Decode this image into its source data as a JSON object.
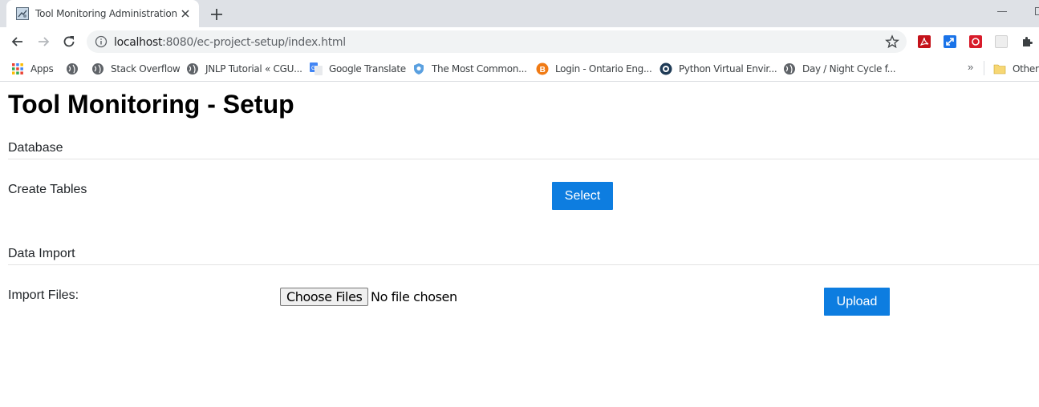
{
  "browser": {
    "tab": {
      "title": "Tool Monitoring Administration",
      "favicon": "tool-page-icon",
      "close_icon": "close-icon"
    },
    "new_tab_icon": "plus-icon",
    "address": {
      "host": "localhost",
      "rest": ":8080/ec-project-setup/index.html"
    },
    "bookmarks": [
      {
        "label": "Apps",
        "icon": "apps-grid-icon"
      },
      {
        "label": "",
        "icon": "globe-icon"
      },
      {
        "label": "Stack Overflow",
        "icon": "globe-icon"
      },
      {
        "label": "JNLP Tutorial « CGU...",
        "icon": "globe-icon"
      },
      {
        "label": "Google Translate",
        "icon": "google-translate-icon"
      },
      {
        "label": "The Most Common...",
        "icon": "shield-icon"
      },
      {
        "label": "Login - Ontario Eng...",
        "icon": "orange-b-icon"
      },
      {
        "label": "Python Virtual Envir...",
        "icon": "python-icon"
      },
      {
        "label": "Day / Night Cycle f...",
        "icon": "globe-icon"
      }
    ],
    "bookmarks_more": "»",
    "other_bookmarks": "Other b"
  },
  "page": {
    "title": "Tool Monitoring - Setup",
    "database": {
      "section_title": "Database",
      "create_tables_label": "Create Tables",
      "select_button": "Select"
    },
    "data_import": {
      "section_title": "Data Import",
      "import_files_label": "Import Files:",
      "choose_files_button": "Choose Files",
      "file_status": "No file chosen",
      "upload_button": "Upload"
    }
  },
  "colors": {
    "primary_button": "#0d7de0",
    "tabstrip": "#dee1e6"
  }
}
